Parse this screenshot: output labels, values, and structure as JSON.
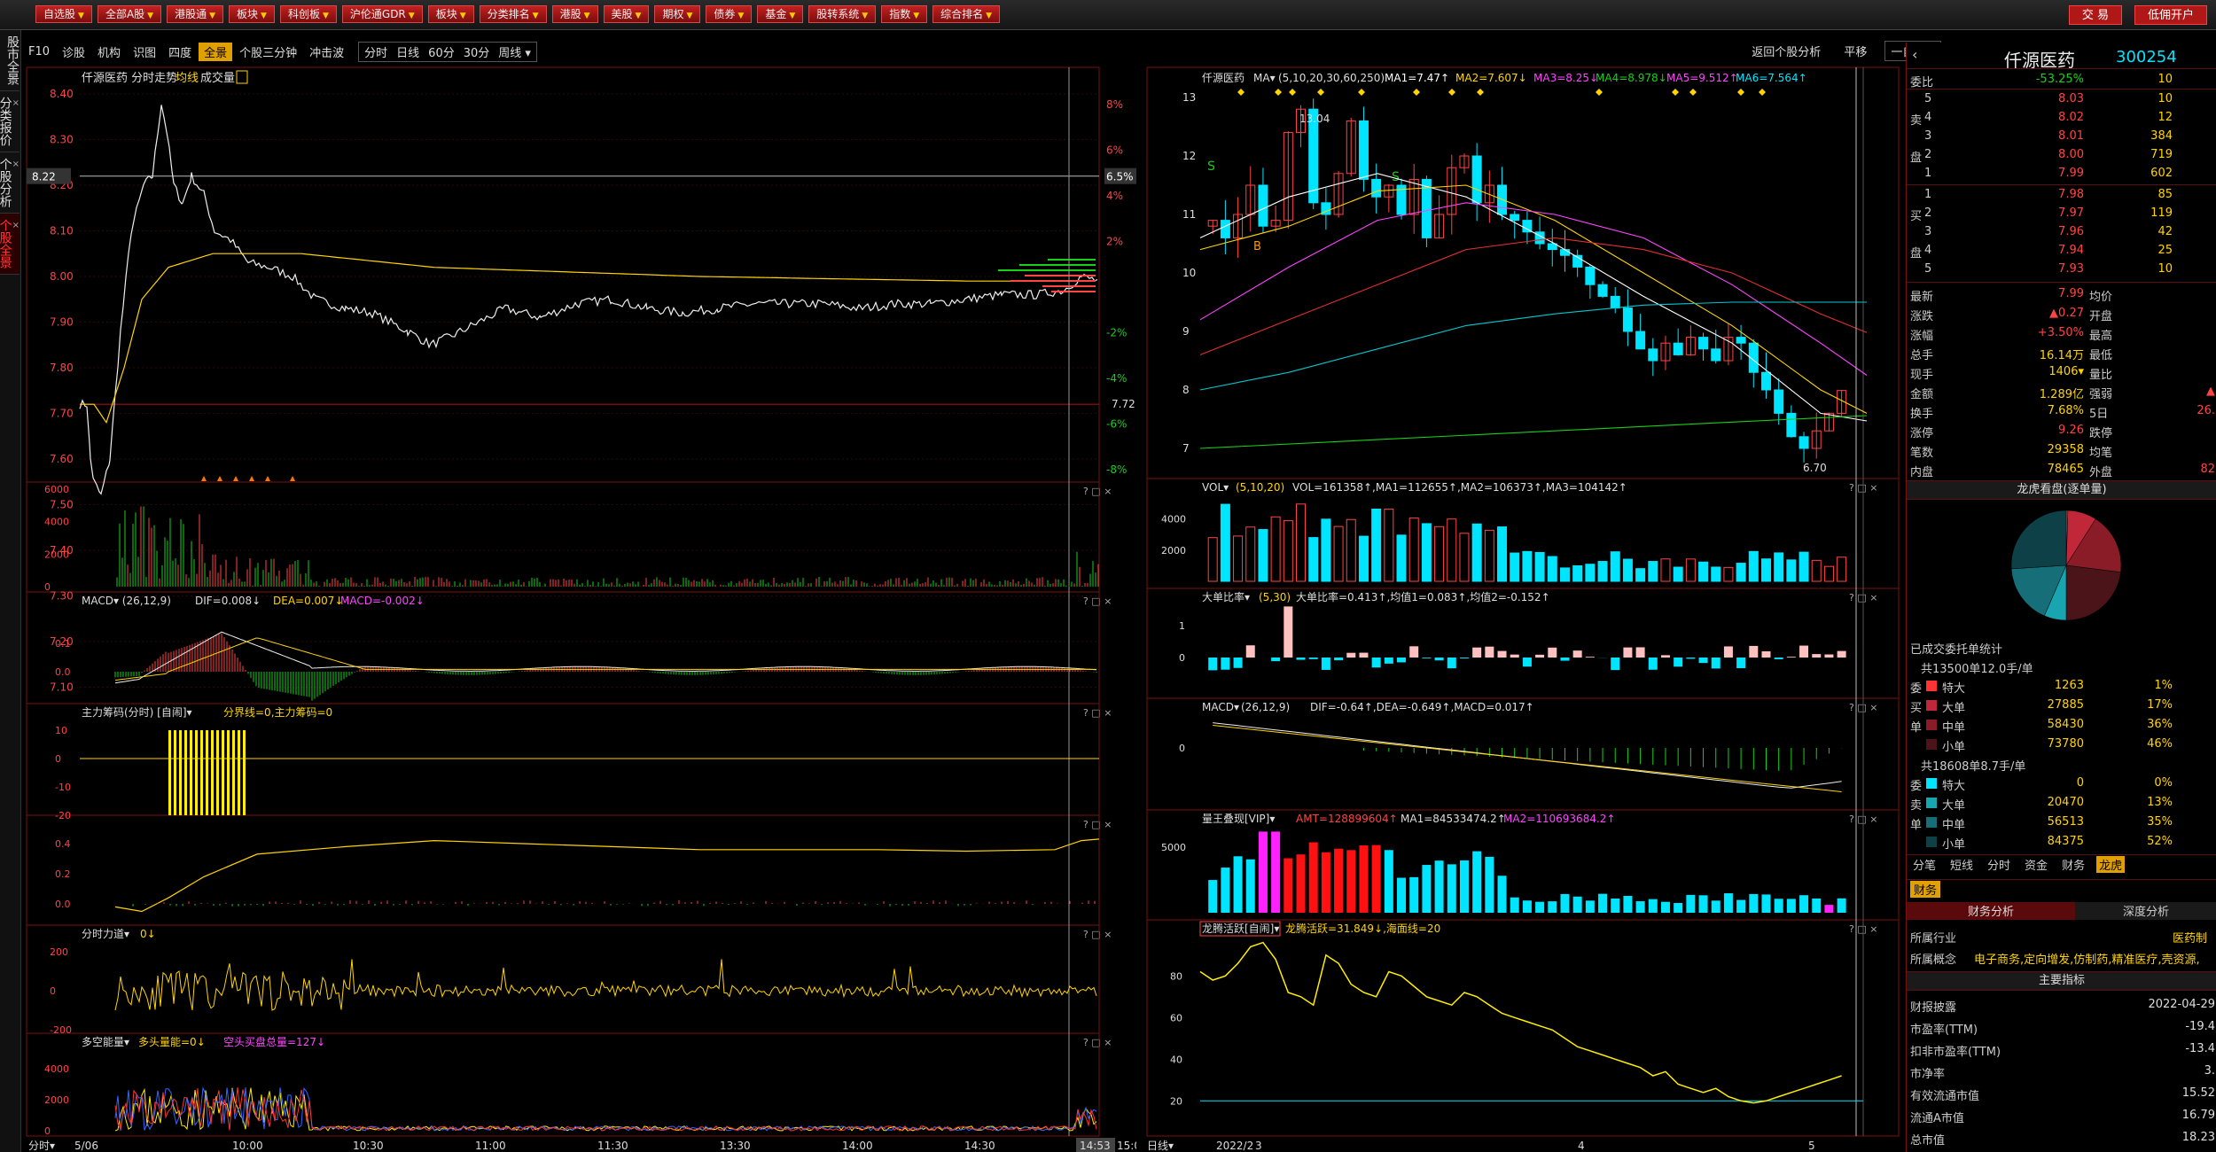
{
  "top_menu": [
    {
      "label": "自选股"
    },
    {
      "label": "全部A股"
    },
    {
      "label": "港股通"
    },
    {
      "label": "板块"
    },
    {
      "label": "科创板"
    },
    {
      "label": "沪伦通GDR"
    },
    {
      "label": "板块"
    },
    {
      "label": "分类排名"
    },
    {
      "label": "港股"
    },
    {
      "label": "美股"
    },
    {
      "label": "期权"
    },
    {
      "label": "债券"
    },
    {
      "label": "基金"
    },
    {
      "label": "股转系统"
    },
    {
      "label": "指数"
    },
    {
      "label": "综合排名"
    }
  ],
  "top_right": {
    "trade": "交 易",
    "open_account": "低佣开户"
  },
  "left_tabs": [
    "股市全景",
    "分类报价",
    "个股分析",
    "个股全景"
  ],
  "toolbar": {
    "items": [
      "F10",
      "诊股",
      "机构",
      "识图",
      "四度",
      "全景",
      "个股三分钟",
      "冲击波"
    ],
    "active": "全景",
    "periods": [
      "分时",
      "日线",
      "60分",
      "30分",
      "周线"
    ],
    "right": [
      "返回个股分析",
      "平移",
      "一自选"
    ]
  },
  "intraday": {
    "title": "仟源医药 分时走势",
    "avg_label": "均线",
    "vol_label": "成交量",
    "price_ticks": [
      "8.40",
      "8.30",
      "8.20",
      "8.10",
      "8.00",
      "7.90",
      "7.80",
      "7.70",
      "7.60",
      "7.50",
      "7.40",
      "7.30",
      "7.20",
      "7.10"
    ],
    "pct_ticks": [
      "8%",
      "6%",
      "4%",
      "2%",
      "",
      "-2%",
      "-4%",
      "-6%",
      "-8%"
    ],
    "current_price": "8.22",
    "current_pct": "6.5%",
    "prev_close": "7.72",
    "vol_ticks": [
      "6000",
      "4000",
      "2000",
      "0"
    ],
    "macd_title": "MACD▾ (26,12,9)",
    "macd_dif": "DIF=0.008↓",
    "macd_dea": "DEA=0.007↓",
    "macd_macd": "MACD=-0.002↓",
    "macd_ticks": [
      "0.1",
      "0.0"
    ],
    "main_title": "主力筹码(分时) [自闹]▾",
    "main_vals": "分界线=0,主力筹码=0",
    "main_ticks": [
      "10",
      "0",
      "-10",
      "-20"
    ],
    "p4_ticks": [
      "0.4",
      "0.2",
      "0.0"
    ],
    "force_title": "分时力道▾",
    "force_val": "0↓",
    "force_ticks": [
      "200",
      "0",
      "-200"
    ],
    "dk_title": "多空能量▾",
    "dk_val1": "多头量能=0↓",
    "dk_val2": "空头买盘总量=127↓",
    "dk_ticks": [
      "4000",
      "2000",
      "0"
    ],
    "time_labels": [
      "分时▾",
      "5/06",
      "10:00",
      "10:30",
      "11:00",
      "11:30",
      "13:30",
      "14:00",
      "14:30",
      "14:53",
      "15:00"
    ]
  },
  "daily": {
    "title": "仟源医药",
    "ma_label": "MA▾",
    "ma_params": "(5,10,20,30,60,250)",
    "ma1": "MA1=7.47↑",
    "ma2": "MA2=7.607↓",
    "ma3": "MA3=8.25↓",
    "ma4": "MA4=8.978↓",
    "ma5": "MA5=9.512↑",
    "ma6": "MA6=7.564↑",
    "price_ticks": [
      "13",
      "12",
      "11",
      "10",
      "9",
      "8",
      "7"
    ],
    "high_label": "13.04",
    "low_label": "6.70",
    "vol_title": "VOL▾",
    "vol_params": "(5,10,20)",
    "vol_vals": "VOL=161358↑,MA1=112655↑,MA2=106373↑,MA3=104142↑",
    "vol_ticks": [
      "4000",
      "2000"
    ],
    "big_title": "大单比率▾",
    "big_params": "(5,30)",
    "big_vals": "大单比率=0.413↑,均值1=0.083↑,均值2=-0.152↑",
    "big_ticks": [
      "1",
      "0"
    ],
    "macd_title": "MACD▾",
    "macd_params": "(26,12,9)",
    "macd_vals": "DIF=-0.64↑,DEA=-0.649↑,MACD=0.017↑",
    "macd_ticks": [
      "0"
    ],
    "qw_title": "量王叠现[VIP]▾",
    "qw_amt": "AMT=128899604↑",
    "qw_ma1": "MA1=84533474.2↑",
    "qw_ma2": "MA2=110693684.2↑",
    "qw_ticks": [
      "5000"
    ],
    "lt_title": "龙腾活跃[自闹]▾",
    "lt_vals": "龙腾活跃=31.849↓,海面线=20",
    "lt_ticks": [
      "80",
      "60",
      "40",
      "20"
    ],
    "date_labels": [
      "日线▾",
      "2022/2",
      "3",
      "4",
      "5"
    ]
  },
  "quote": {
    "name": "仟源医药",
    "code": "300254",
    "wb_label": "委比",
    "wb_val": "-53.25%",
    "wb_diff": "10",
    "asks": [
      {
        "lv": "5",
        "price": "8.03",
        "vol": "10"
      },
      {
        "lv": "4",
        "price": "8.02",
        "vol": "12"
      },
      {
        "lv": "3",
        "price": "8.01",
        "vol": "384"
      },
      {
        "lv": "2",
        "price": "8.00",
        "vol": "719"
      },
      {
        "lv": "1",
        "price": "7.99",
        "vol": "602"
      }
    ],
    "bids": [
      {
        "lv": "1",
        "price": "7.98",
        "vol": "85"
      },
      {
        "lv": "2",
        "price": "7.97",
        "vol": "119"
      },
      {
        "lv": "3",
        "price": "7.96",
        "vol": "42"
      },
      {
        "lv": "4",
        "price": "7.94",
        "vol": "25"
      },
      {
        "lv": "5",
        "price": "7.93",
        "vol": "10"
      }
    ],
    "sell_side_chars": [
      "卖",
      "盘"
    ],
    "buy_side_chars": [
      "买",
      "盘"
    ],
    "stats": [
      {
        "l": "最新",
        "v": "7.99",
        "l2": "均价",
        "v2": ""
      },
      {
        "l": "涨跌",
        "v": "▲0.27",
        "l2": "开盘",
        "v2": ""
      },
      {
        "l": "涨幅",
        "v": "+3.50%",
        "l2": "最高",
        "v2": ""
      },
      {
        "l": "总手",
        "v": "16.14万",
        "l2": "最低",
        "v2": ""
      },
      {
        "l": "现手",
        "v": "1406▾",
        "l2": "量比",
        "v2": ""
      },
      {
        "l": "金额",
        "v": "1.289亿",
        "l2": "强弱",
        "v2": "▲"
      },
      {
        "l": "换手",
        "v": "7.68%",
        "l2": "5日",
        "v2": "26."
      },
      {
        "l": "涨停",
        "v": "9.26",
        "l2": "跌停",
        "v2": ""
      },
      {
        "l": "笔数",
        "v": "29358",
        "l2": "均笔",
        "v2": ""
      },
      {
        "l": "内盘",
        "v": "78465",
        "l2": "外盘",
        "v2": "82"
      }
    ],
    "pie_title": "龙虎看盘(逐单量)",
    "pie_slices": [
      {
        "value": 1,
        "color": "#ff3333"
      },
      {
        "value": 17,
        "color": "#c0283a"
      },
      {
        "value": 36,
        "color": "#8a1c28"
      },
      {
        "value": 46,
        "color": "#4a1418"
      },
      {
        "value": 0,
        "color": "#00e5ff"
      },
      {
        "value": 13,
        "color": "#19a5b0"
      },
      {
        "value": 35,
        "color": "#166f78"
      },
      {
        "value": 52,
        "color": "#0e4048"
      }
    ],
    "order_title": "已成交委托单统计",
    "buy_summary": "共13500单12.0手/单",
    "sell_summary": "共18608单8.7手/单",
    "side_buy": [
      "委",
      "买",
      "单"
    ],
    "side_sell": [
      "委",
      "卖",
      "单"
    ],
    "buy_rows": [
      {
        "name": "特大",
        "vol": "1263",
        "pct": "1%",
        "color": "#ff3333"
      },
      {
        "name": "大单",
        "vol": "27885",
        "pct": "17%",
        "color": "#c0283a"
      },
      {
        "name": "中单",
        "vol": "58430",
        "pct": "36%",
        "color": "#8a1c28"
      },
      {
        "name": "小单",
        "vol": "73780",
        "pct": "46%",
        "color": "#4a1418"
      }
    ],
    "sell_rows": [
      {
        "name": "特大",
        "vol": "0",
        "pct": "0%",
        "color": "#00e5ff"
      },
      {
        "name": "大单",
        "vol": "20470",
        "pct": "13%",
        "color": "#19a5b0"
      },
      {
        "name": "中单",
        "vol": "56513",
        "pct": "35%",
        "color": "#166f78"
      },
      {
        "name": "小单",
        "vol": "84375",
        "pct": "52%",
        "color": "#0e4048"
      }
    ],
    "tabs": [
      "分笔",
      "短线",
      "分时",
      "资金",
      "财务",
      "龙虎"
    ],
    "active_tab": "龙虎",
    "fin_tab": "财务",
    "fin_sub": [
      "财务分析",
      "深度分析"
    ],
    "industry_label": "所属行业",
    "industry_val": "医药制",
    "concept_label": "所属概念",
    "concept_val": "电子商务,定向增发,仿制药,精准医疗,壳资源,",
    "indicators_head": "主要指标",
    "fin_rows": [
      {
        "l": "财报披露",
        "v": "2022-04-29"
      },
      {
        "l": "市盈率(TTM)",
        "v": "-19.4"
      },
      {
        "l": "扣非市盈率(TTM)",
        "v": "-13.4"
      },
      {
        "l": "市净率",
        "v": "3."
      },
      {
        "l": "有效流通市值",
        "v": "15.52"
      },
      {
        "l": "流通A市值",
        "v": "16.79"
      },
      {
        "l": "总市值",
        "v": "18.23"
      }
    ]
  }
}
